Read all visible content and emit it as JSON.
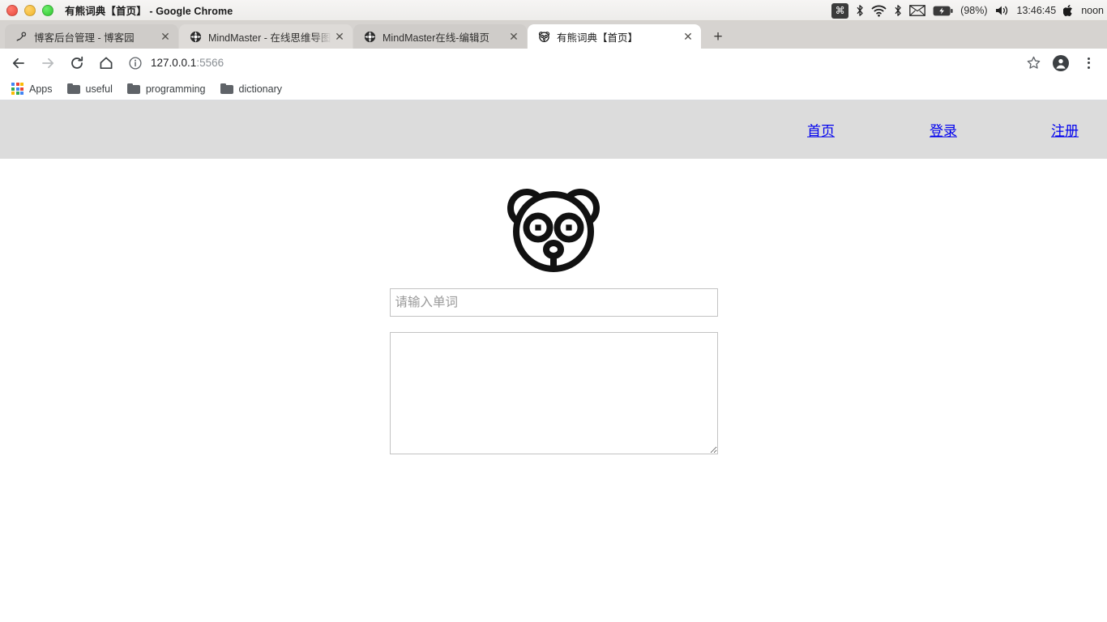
{
  "window": {
    "title": "有熊词典【首页】 - Google Chrome",
    "traffic_lights": [
      "close",
      "minimize",
      "maximize"
    ]
  },
  "tray": {
    "command_key": "⌘",
    "bluetooth_1": "bluetooth-icon",
    "wifi": "wifi-icon",
    "bluetooth_2": "bluetooth-icon",
    "mail": "mail-icon",
    "battery_icon": "battery-icon",
    "battery_percent": "(98%)",
    "volume": "volume-icon",
    "time": "13:46:45",
    "apple": "",
    "session_label": "noon"
  },
  "tabs": [
    {
      "title": "博客后台管理 - 博客园",
      "favicon": "blog-favicon",
      "active": false,
      "hovered": false,
      "close": "✕"
    },
    {
      "title": "MindMaster - 在线思维导图",
      "favicon": "mindmaster-favicon",
      "active": false,
      "hovered": true,
      "close": "✕"
    },
    {
      "title": "MindMaster在线-编辑页",
      "favicon": "mindmaster-favicon",
      "active": false,
      "hovered": false,
      "close": "✕"
    },
    {
      "title": "有熊词典【首页】",
      "favicon": "panda-favicon",
      "active": true,
      "hovered": false,
      "close": "✕"
    }
  ],
  "newtab_label": "+",
  "toolbar": {
    "back": "back-arrow-icon",
    "forward": "forward-arrow-icon",
    "reload": "reload-icon",
    "home": "home-icon",
    "site_info": "info-icon",
    "url_host": "127.0.0.1",
    "url_port": ":5566",
    "bookmark_star": "star-icon",
    "profile": "profile-avatar-icon",
    "menu": "three-dot-menu-icon"
  },
  "bookmarks": [
    {
      "label": "Apps",
      "icon": "apps-grid-icon"
    },
    {
      "label": "useful",
      "icon": "folder-icon"
    },
    {
      "label": "programming",
      "icon": "folder-icon"
    },
    {
      "label": "dictionary",
      "icon": "folder-icon"
    }
  ],
  "page": {
    "header_bg": "#dcdcdc",
    "link_color": "#0000ee",
    "nav": [
      {
        "label": "首页"
      },
      {
        "label": "登录"
      },
      {
        "label": "注册"
      }
    ],
    "logo": "panda-logo",
    "search": {
      "value": "",
      "placeholder": "请输入单词"
    },
    "result": {
      "value": "",
      "placeholder": ""
    }
  }
}
